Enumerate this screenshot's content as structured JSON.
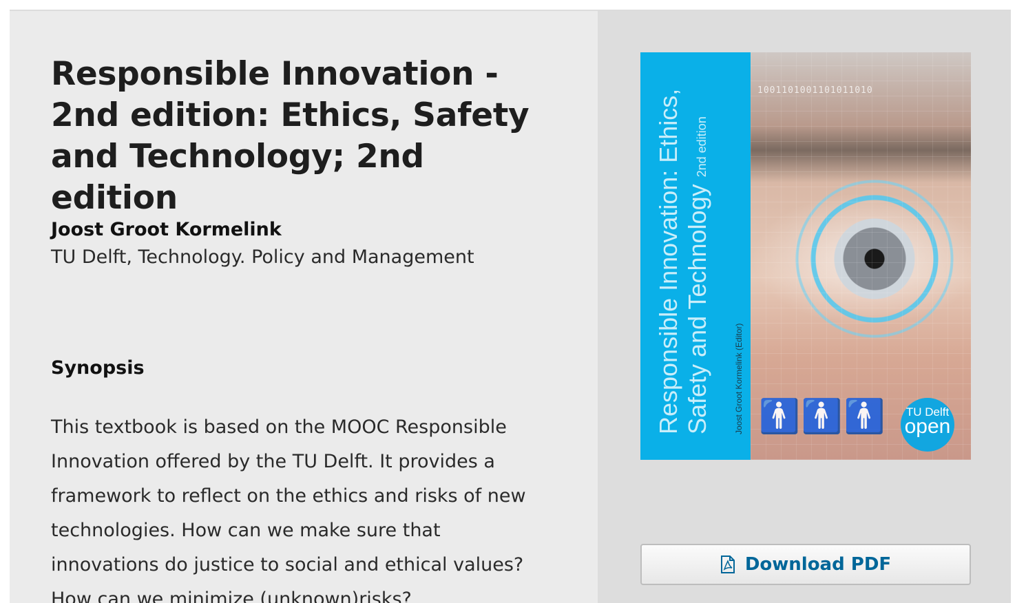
{
  "book": {
    "title": "Responsible Innovation - 2nd edition: Ethics, Safety and Technology; 2nd edition",
    "author_name": "Joost Groot Kormelink",
    "author_affiliation": "TU Delft, Technology. Policy and Management"
  },
  "synopsis": {
    "heading": "Synopsis",
    "text": "This textbook is based on the MOOC Responsible Innovation offered by the TU Delft. It provides a framework to reflect on the ethics and risks of new technologies. How can we make sure that innovations do justice to social and ethical values? How can we minimize (unknown)risks?"
  },
  "cover": {
    "title_line1": "Responsible Innovation: Ethics,",
    "title_line2": "Safety and Technology",
    "edition": "2nd edition",
    "editor": "Joost Groot Kormelink (Editor)",
    "badge_line1": "TU Delft",
    "badge_line2": "open",
    "binary": "1001101001101011010",
    "spine_color": "#0ab0e8"
  },
  "actions": {
    "download_label": "Download PDF",
    "download_icon": "pdf-file-icon",
    "accent_color": "#006699"
  }
}
